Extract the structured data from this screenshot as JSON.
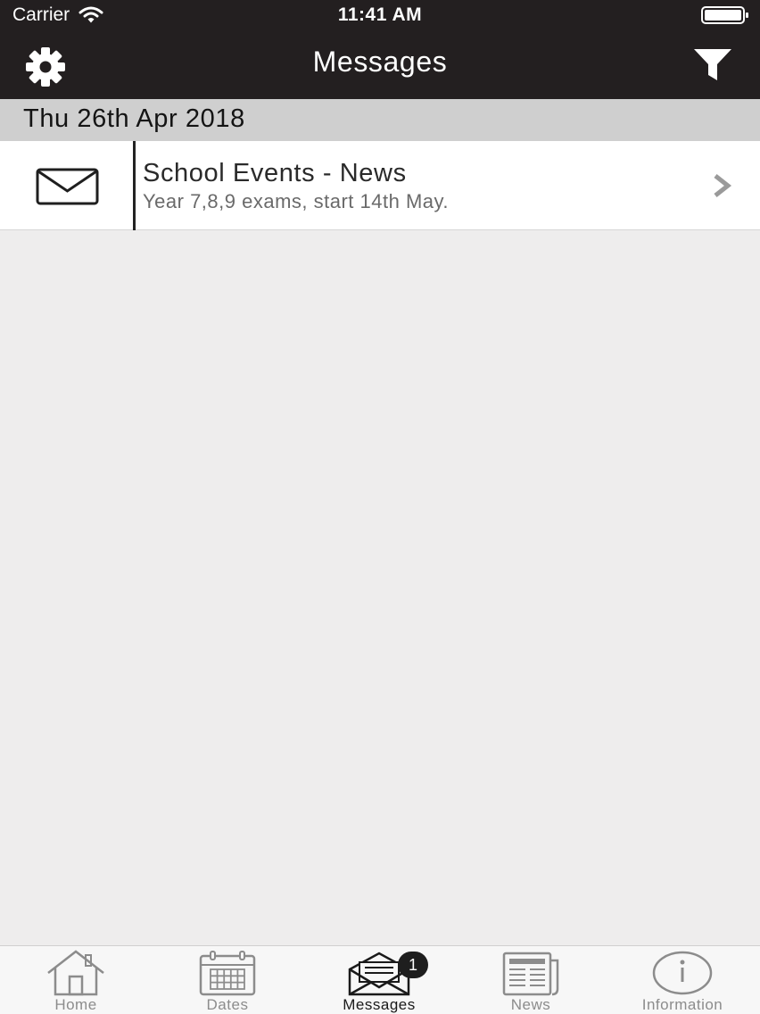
{
  "status_bar": {
    "carrier": "Carrier",
    "time": "11:41 AM"
  },
  "nav": {
    "title": "Messages",
    "left_icon": "gear-icon",
    "right_icon": "filter-icon"
  },
  "section": {
    "date": "Thu 26th Apr 2018"
  },
  "messages": [
    {
      "title": "School Events - News",
      "subtitle": "Year 7,8,9 exams, start 14th May.",
      "icon": "envelope-icon"
    }
  ],
  "tabs": [
    {
      "label": "Home",
      "icon": "home-icon",
      "active": false
    },
    {
      "label": "Dates",
      "icon": "calendar-icon",
      "active": false
    },
    {
      "label": "Messages",
      "icon": "open-envelope-icon",
      "active": true,
      "badge": "1"
    },
    {
      "label": "News",
      "icon": "newspaper-icon",
      "active": false
    },
    {
      "label": "Information",
      "icon": "info-icon",
      "active": false
    }
  ],
  "colors": {
    "nav_background": "#231f20",
    "section_background": "#cfcfcf",
    "content_background": "#eeeded",
    "tab_active": "#1a1a1a",
    "tab_inactive": "#8c8c8c"
  }
}
